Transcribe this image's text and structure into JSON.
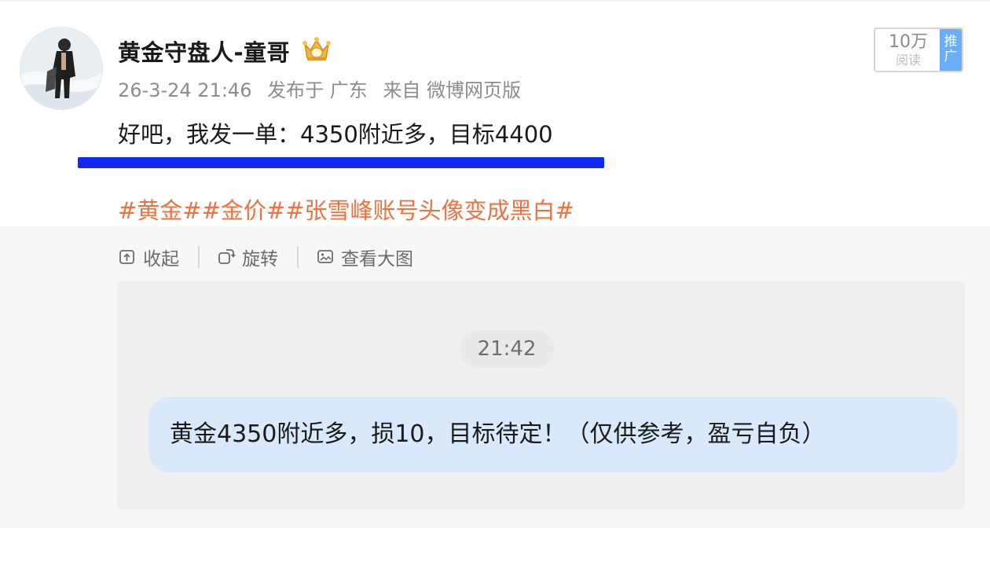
{
  "author": {
    "name": "黄金守盘人-童哥",
    "avatar_icon": "avatar-photo",
    "badge_icon": "crown-icon"
  },
  "meta": {
    "datetime": "26-3-24 21:46",
    "location": "发布于 广东",
    "source": "来自 微博网页版"
  },
  "stats": {
    "read_count": "10万",
    "read_label": "阅读",
    "promo_label": "推广"
  },
  "post": {
    "text": "好吧，我发一单：4350附近多，目标4400",
    "hashtags": "#黄金##金价##张雪峰账号头像变成黑白#"
  },
  "toolbar": {
    "collapse_label": "收起",
    "rotate_label": "旋转",
    "view_large_label": "查看大图"
  },
  "image": {
    "chat_time": "21:42",
    "message": "黄金4350附近多，损10，目标待定！（仅供参考，盈亏自负）"
  },
  "colors": {
    "hashtag": "#eb7340",
    "promo_bg": "#6aaef5",
    "underline": "#1126ee",
    "bubble": "#d8e9fb"
  }
}
